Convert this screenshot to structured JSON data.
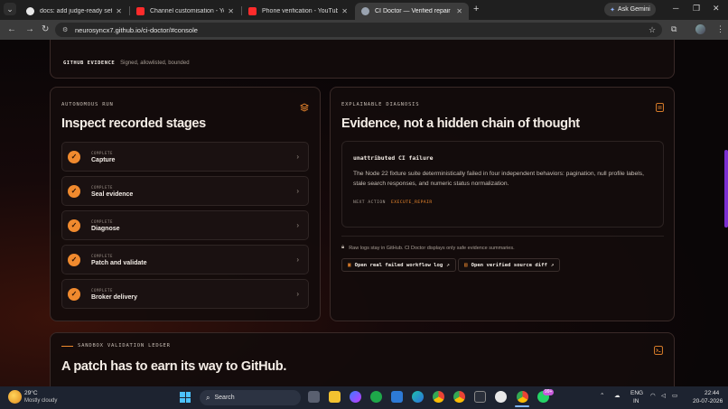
{
  "browser": {
    "tabs": [
      {
        "title": "docs: add judge-ready setup ar",
        "favicon": "github-icon",
        "active": false
      },
      {
        "title": "Channel customisation - YouTu",
        "favicon": "youtube-icon",
        "active": false
      },
      {
        "title": "Phone verification - YouTube",
        "favicon": "youtube-icon",
        "active": false
      },
      {
        "title": "CI Doctor — Verified repair",
        "favicon": "globe-icon",
        "active": true
      }
    ],
    "new_tab": "+",
    "ask_gemini": "Ask Gemini",
    "url": "neurosyncx7.github.io/ci-doctor/#console"
  },
  "evidence_strip": {
    "label": "GITHUB EVIDENCE",
    "text": "Signed, allowlisted, bounded"
  },
  "autonomous_run": {
    "eyebrow": "AUTONOMOUS RUN",
    "title": "Inspect recorded stages",
    "stages": [
      {
        "status": "COMPLETE",
        "name": "Capture"
      },
      {
        "status": "COMPLETE",
        "name": "Seal evidence"
      },
      {
        "status": "COMPLETE",
        "name": "Diagnose"
      },
      {
        "status": "COMPLETE",
        "name": "Patch and validate"
      },
      {
        "status": "COMPLETE",
        "name": "Broker delivery"
      }
    ]
  },
  "diagnosis": {
    "eyebrow": "EXPLAINABLE DIAGNOSIS",
    "title": "Evidence, not a hidden chain of thought",
    "failure_title": "unattributed CI failure",
    "failure_text": "The Node 22 fixture suite deterministically failed in four independent behaviors: pagination, null profile labels, stale search responses, and numeric status normalization.",
    "next_action_label": "NEXT ACTION",
    "next_action_value": "EXECUTE_REPAIR",
    "note": "Raw logs stay in GitHub. CI Doctor displays only safe evidence summaries.",
    "button_log": "Open real failed workflow log",
    "button_diff": "Open verified source diff"
  },
  "ledger": {
    "eyebrow": "SANDBOX VALIDATION LEDGER",
    "title": "A patch has to earn its way to GitHub."
  },
  "taskbar": {
    "weather_temp": "29°C",
    "weather_text": "Mostly cloudy",
    "search": "Search",
    "lang_top": "ENG",
    "lang_bottom": "IN",
    "time": "22:44",
    "date": "20-07-2026",
    "badge": "99+"
  },
  "colors": {
    "accent": "#f08a2e",
    "page_bg": "#0b0708",
    "card_border": "#3a2a28"
  }
}
